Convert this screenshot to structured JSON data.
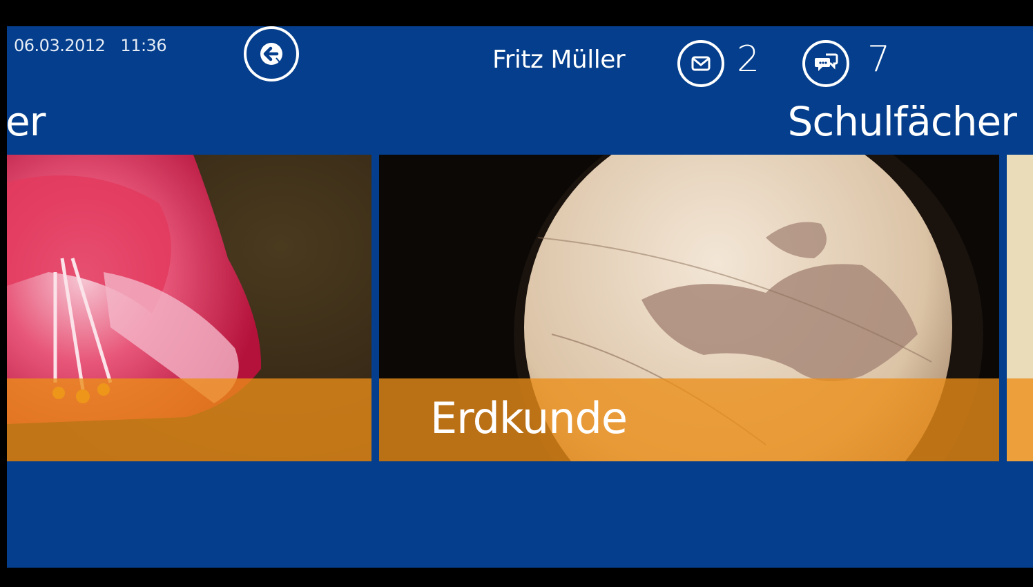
{
  "status": {
    "date": "06.03.2012",
    "time": "11:36"
  },
  "user": {
    "name": "Fritz Müller"
  },
  "messages": {
    "count": "2",
    "icon": "envelope-icon"
  },
  "chats": {
    "count": "7",
    "icon": "chat-bubbles-icon"
  },
  "sections": {
    "previous_partial": "er",
    "current": "Schulfächer"
  },
  "tiles": [
    {
      "label": "",
      "image": "red-amaryllis-flower"
    },
    {
      "label": "Erdkunde",
      "image": "globe"
    },
    {
      "label": "",
      "image": "partial-next-tile"
    }
  ],
  "colors": {
    "background": "#043e8c",
    "band": "#ec8e18",
    "frame": "#000000"
  }
}
